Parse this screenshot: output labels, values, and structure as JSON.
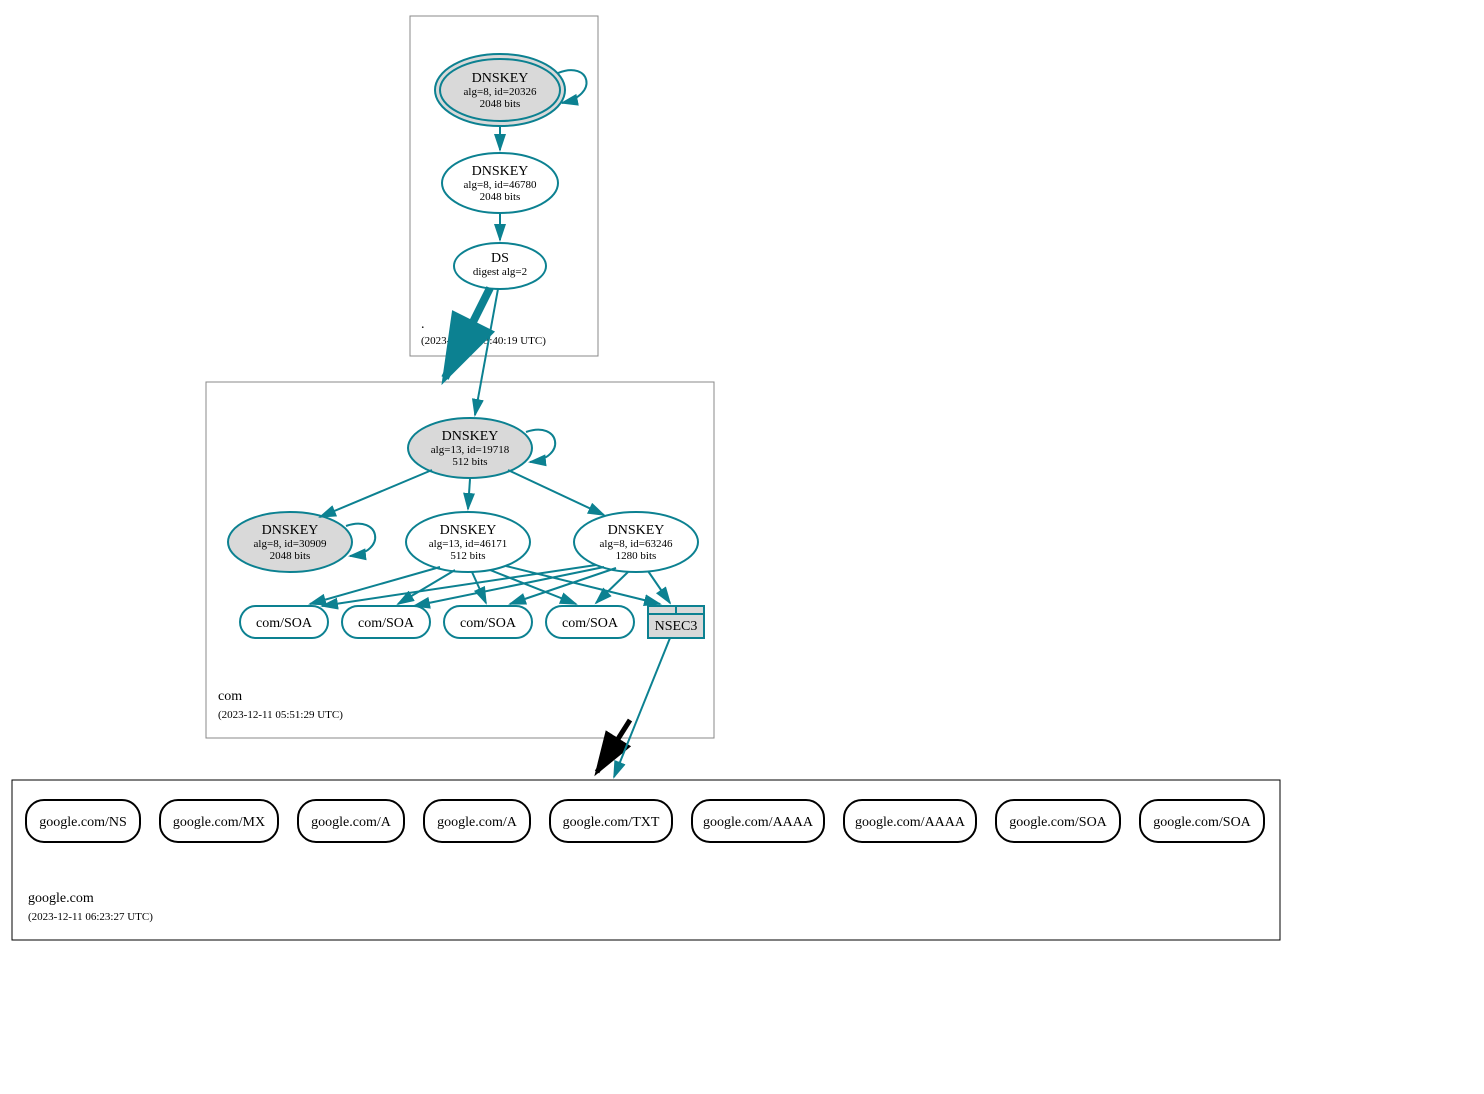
{
  "zones": {
    "root": {
      "name": ".",
      "ts": "(2023-12-11 03:40:19 UTC)"
    },
    "com": {
      "name": "com",
      "ts": "(2023-12-11 05:51:29 UTC)"
    },
    "google": {
      "name": "google.com",
      "ts": "(2023-12-11 06:23:27 UTC)"
    }
  },
  "nodes": {
    "r1": {
      "t": "DNSKEY",
      "s1": "alg=8, id=20326",
      "s2": "2048 bits"
    },
    "r2": {
      "t": "DNSKEY",
      "s1": "alg=8, id=46780",
      "s2": "2048 bits"
    },
    "r3": {
      "t": "DS",
      "s1": "digest alg=2"
    },
    "c1": {
      "t": "DNSKEY",
      "s1": "alg=13, id=19718",
      "s2": "512 bits"
    },
    "c2": {
      "t": "DNSKEY",
      "s1": "alg=8, id=30909",
      "s2": "2048 bits"
    },
    "c3": {
      "t": "DNSKEY",
      "s1": "alg=13, id=46171",
      "s2": "512 bits"
    },
    "c4": {
      "t": "DNSKEY",
      "s1": "alg=8, id=63246",
      "s2": "1280 bits"
    },
    "soa1": {
      "t": "com/SOA"
    },
    "soa2": {
      "t": "com/SOA"
    },
    "soa3": {
      "t": "com/SOA"
    },
    "soa4": {
      "t": "com/SOA"
    },
    "nsec3": {
      "t": "NSEC3"
    },
    "g1": {
      "t": "google.com/NS"
    },
    "g2": {
      "t": "google.com/MX"
    },
    "g3": {
      "t": "google.com/A"
    },
    "g4": {
      "t": "google.com/A"
    },
    "g5": {
      "t": "google.com/TXT"
    },
    "g6": {
      "t": "google.com/AAAA"
    },
    "g7": {
      "t": "google.com/AAAA"
    },
    "g8": {
      "t": "google.com/SOA"
    },
    "g9": {
      "t": "google.com/SOA"
    }
  }
}
